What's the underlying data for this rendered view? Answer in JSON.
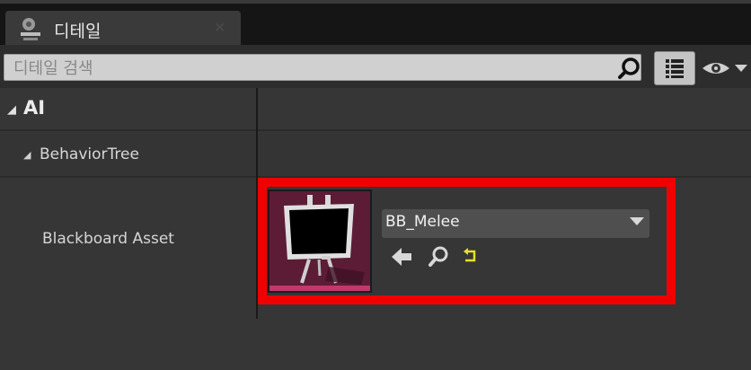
{
  "tab": {
    "title": "디테일",
    "icon": "details-panel-icon",
    "close_icon": "close-icon"
  },
  "search": {
    "placeholder": "디테일 검색",
    "value": ""
  },
  "toolbar": {
    "view_options_icon": "grid-view-icon",
    "visibility_icon": "eye-icon"
  },
  "categories": [
    {
      "label": "AI",
      "expanded": true
    },
    {
      "label": "BehaviorTree",
      "expanded": true
    }
  ],
  "property": {
    "label": "Blackboard Asset",
    "asset_value": "BB_Melee",
    "thumbnail_icon": "blackboard-easel-icon",
    "actions": [
      "use-selected-arrow-icon",
      "browse-search-icon",
      "reset-to-default-icon"
    ]
  },
  "colors": {
    "highlight": "#f00000",
    "thumbnail_bg": "#5c1c36",
    "thumbnail_bar": "#c2386a",
    "reset_icon": "#e8e020"
  }
}
